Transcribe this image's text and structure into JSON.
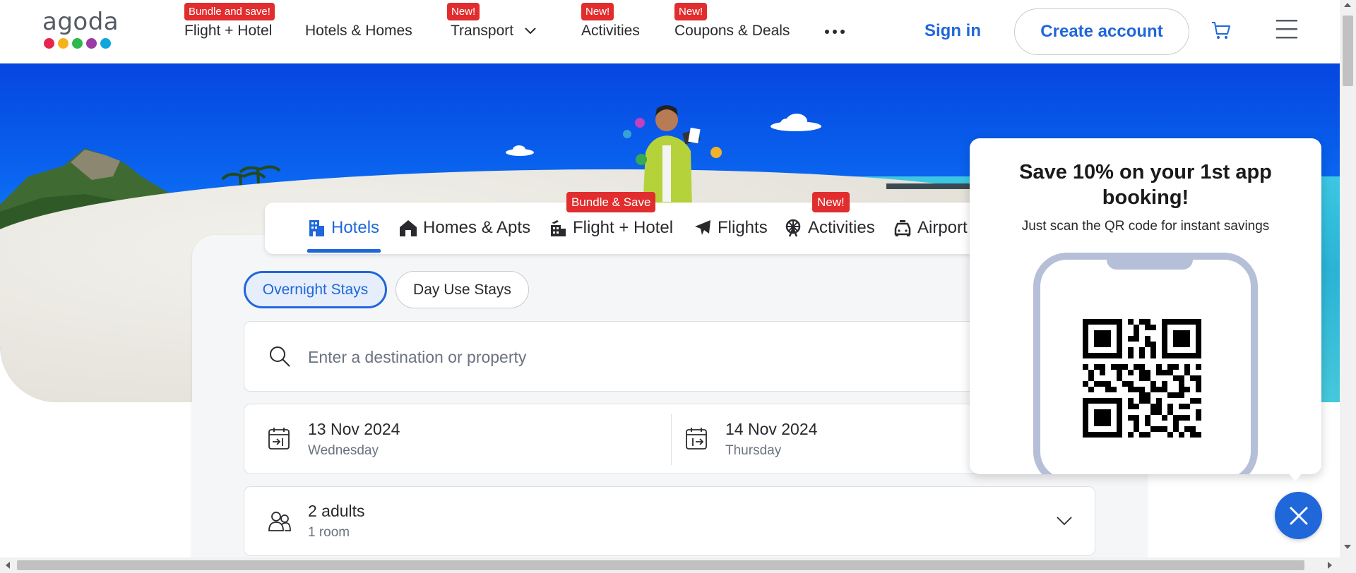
{
  "brand": {
    "logo_text": "agoda",
    "dot_colors": [
      "#e6254f",
      "#f6b21a",
      "#2db84c",
      "#9c3aa6",
      "#10a6dc"
    ]
  },
  "colors": {
    "accent": "#2067da",
    "badge": "#e12d2d",
    "text": "#2a2a2e"
  },
  "nav": {
    "items": [
      {
        "label": "Flight + Hotel",
        "badge": "Bundle and save!"
      },
      {
        "label": "Hotels & Homes",
        "badge": ""
      },
      {
        "label": "Transport",
        "badge": "New!"
      },
      {
        "label": "Activities",
        "badge": "New!"
      },
      {
        "label": "Coupons & Deals",
        "badge": "New!"
      }
    ],
    "more_icon": "ellipsis-icon",
    "sign_in": "Sign in",
    "create_account": "Create account",
    "cart_icon": "cart-icon",
    "menu_icon": "hamburger-menu-icon"
  },
  "search_tabs": {
    "tabs": [
      {
        "label": "Hotels",
        "icon": "hotel-building-icon",
        "active": true
      },
      {
        "label": "Homes & Apts",
        "icon": "house-icon",
        "badge": ""
      },
      {
        "label": "Flight + Hotel",
        "icon": "flight-hotel-icon",
        "badge": "Bundle & Save"
      },
      {
        "label": "Flights",
        "icon": "airplane-icon"
      },
      {
        "label": "Activities",
        "icon": "ferris-wheel-icon",
        "badge": "New!"
      },
      {
        "label": "Airport",
        "icon": "car-icon"
      }
    ]
  },
  "stay_type": {
    "overnight": "Overnight Stays",
    "day_use": "Day Use Stays",
    "selected": "Overnight Stays"
  },
  "destination": {
    "placeholder": "Enter a destination or property",
    "value": ""
  },
  "dates": {
    "check_in": {
      "date": "13 Nov 2024",
      "day": "Wednesday"
    },
    "check_out": {
      "date": "14 Nov 2024",
      "day": "Thursday"
    }
  },
  "guests": {
    "summary": "2 adults",
    "rooms": "1 room"
  },
  "promo": {
    "title": "Save 10% on your 1st app booking!",
    "subtitle": "Just scan the QR code for instant savings"
  }
}
